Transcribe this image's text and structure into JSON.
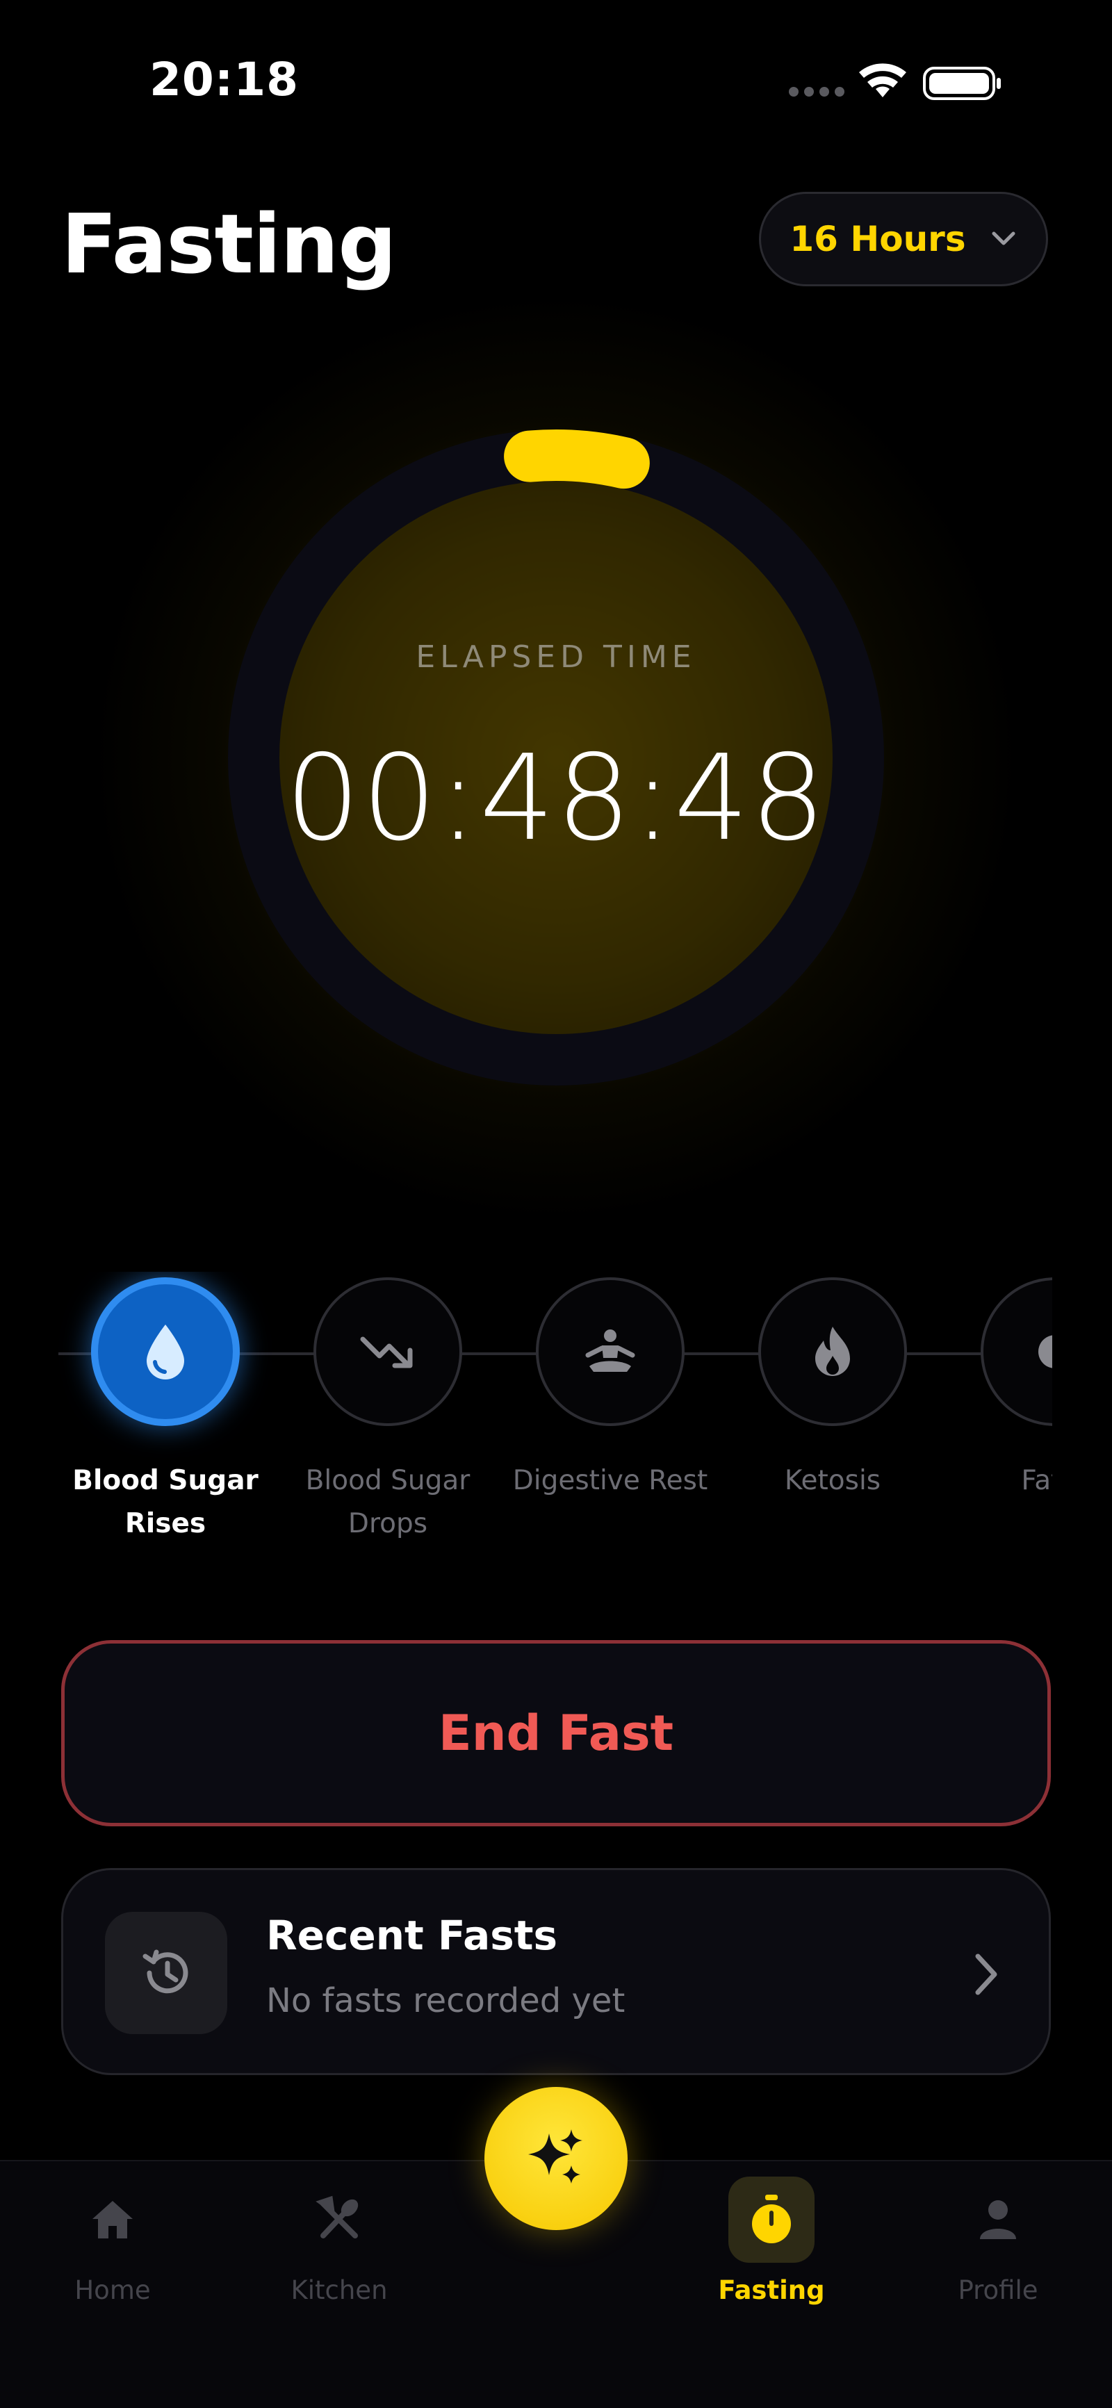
{
  "status_bar": {
    "time": "20:18"
  },
  "header": {
    "title": "Fasting",
    "duration_label": "16 Hours"
  },
  "timer": {
    "label": "ELAPSED TIME",
    "elapsed": "00:48:48",
    "progress_fraction": 0.05
  },
  "colors": {
    "accent": "#ffd500",
    "stage_active": "#2f8cf0",
    "end_fast": "#f05a55",
    "background": "#000000"
  },
  "stages": [
    {
      "label_line1": "Blood Sugar",
      "label_line2": "Rises",
      "icon": "water-drop-icon",
      "active": true
    },
    {
      "label_line1": "Blood Sugar",
      "label_line2": "Drops",
      "icon": "trending-down-icon",
      "active": false
    },
    {
      "label_line1": "Digestive Rest",
      "label_line2": "",
      "icon": "meditation-icon",
      "active": false
    },
    {
      "label_line1": "Ketosis",
      "label_line2": "",
      "icon": "flame-icon",
      "active": false
    },
    {
      "label_line1": "Fat B",
      "label_line2": "",
      "icon": "fat-burn-icon",
      "active": false
    }
  ],
  "end_fast": {
    "label": "End Fast"
  },
  "recent_fasts": {
    "title": "Recent Fasts",
    "subtitle": "No fasts recorded yet",
    "icon": "history-icon"
  },
  "tabbar": {
    "tabs": [
      {
        "label": "Home",
        "icon": "home-icon",
        "active": false
      },
      {
        "label": "Kitchen",
        "icon": "utensils-icon",
        "active": false
      },
      {
        "label": "Fasting",
        "icon": "stopwatch-icon",
        "active": true
      },
      {
        "label": "Profile",
        "icon": "person-icon",
        "active": false
      }
    ],
    "fab_icon": "sparkles-icon"
  }
}
